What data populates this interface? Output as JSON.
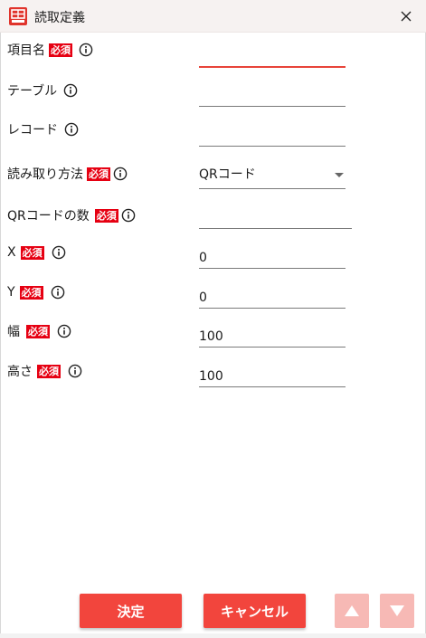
{
  "window": {
    "title": "読取定義",
    "app_icon": "app-logo-icon",
    "close_icon": "close-icon"
  },
  "colors": {
    "accent": "#f2453d",
    "required_badge": "#e60012",
    "disabled_arrow": "#f7b9b5",
    "titlebar": "#f6f2f1"
  },
  "required_label": "必須",
  "fields": {
    "item_name": {
      "label": "項目名",
      "value": "",
      "required": true
    },
    "table": {
      "label": "テーブル",
      "value": "",
      "required": false
    },
    "record": {
      "label": "レコード",
      "value": "",
      "required": false
    },
    "read_method": {
      "label": "読み取り方法",
      "value": "QRコード",
      "required": true
    },
    "qr_count": {
      "label": "QRコードの数",
      "value": "",
      "required": true
    },
    "x": {
      "label": "X",
      "value": "0",
      "required": true
    },
    "y": {
      "label": "Y",
      "value": "0",
      "required": true
    },
    "width": {
      "label": "幅",
      "value": "100",
      "required": true
    },
    "height": {
      "label": "高さ",
      "value": "100",
      "required": true
    }
  },
  "buttons": {
    "confirm_label": "決定",
    "cancel_label": "キャンセル",
    "move_up_icon": "arrow-up-icon",
    "move_down_icon": "arrow-down-icon"
  }
}
